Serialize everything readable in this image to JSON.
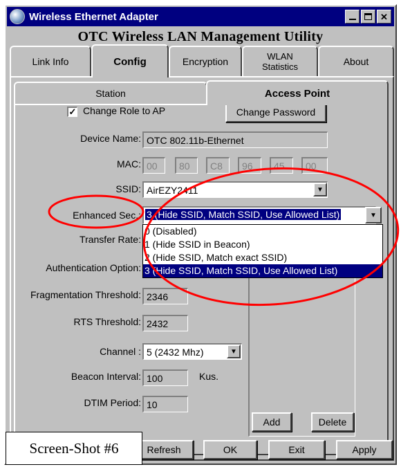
{
  "window": {
    "title": "Wireless Ethernet Adapter",
    "utility_title": "OTC Wireless LAN Management Utility"
  },
  "tabs": [
    {
      "label": "Link Info",
      "active": false
    },
    {
      "label": "Config",
      "active": true
    },
    {
      "label": "Encryption",
      "active": false
    },
    {
      "label": "WLAN\nStatistics",
      "active": false
    },
    {
      "label": "About",
      "active": false
    }
  ],
  "subtabs": [
    {
      "label": "Station",
      "active": false
    },
    {
      "label": "Access Point",
      "active": true
    }
  ],
  "form": {
    "change_role_label": "Change Role to AP",
    "change_role_checked": true,
    "change_password_label": "Change Password",
    "device_name_label": "Device Name:",
    "device_name_value": "OTC 802.11b-Ethernet",
    "mac_label": "MAC:",
    "mac_octets": [
      "00",
      "80",
      "C8",
      "96",
      "45",
      "00"
    ],
    "ssid_label": "SSID:",
    "ssid_value": "AirEZY2411",
    "enhanced_sec_label": "Enhanced Sec.:",
    "enhanced_sec_value": "3 (Hide SSID, Match SSID, Use Allowed List)",
    "enhanced_sec_options": [
      "0 (Disabled)",
      "1 (Hide SSID in Beacon)",
      "2 (Hide SSID, Match exact SSID)",
      "3 (Hide SSID, Match SSID, Use Allowed List)"
    ],
    "enhanced_sec_selected_index": 3,
    "transfer_rate_label": "Transfer Rate:",
    "authentication_label": "Authentication Option:",
    "fragmentation_label": "Fragmentation Threshold:",
    "fragmentation_value": "2346",
    "rts_label": "RTS Threshold:",
    "rts_value": "2432",
    "channel_label": "Channel :",
    "channel_value": "5  (2432 Mhz)",
    "beacon_label": "Beacon Interval:",
    "beacon_value": "100",
    "beacon_unit": "Kus.",
    "dtim_label": "DTIM Period:",
    "dtim_value": "10",
    "add_label": "Add",
    "delete_label": "Delete"
  },
  "footer": {
    "refresh_label": "Refresh",
    "ok_label": "OK",
    "exit_label": "Exit",
    "apply_label": "Apply"
  },
  "caption": "Screen-Shot #6",
  "colors": {
    "titlebar": "#000080",
    "face": "#c0c0c0",
    "annotation": "#ff0000"
  }
}
